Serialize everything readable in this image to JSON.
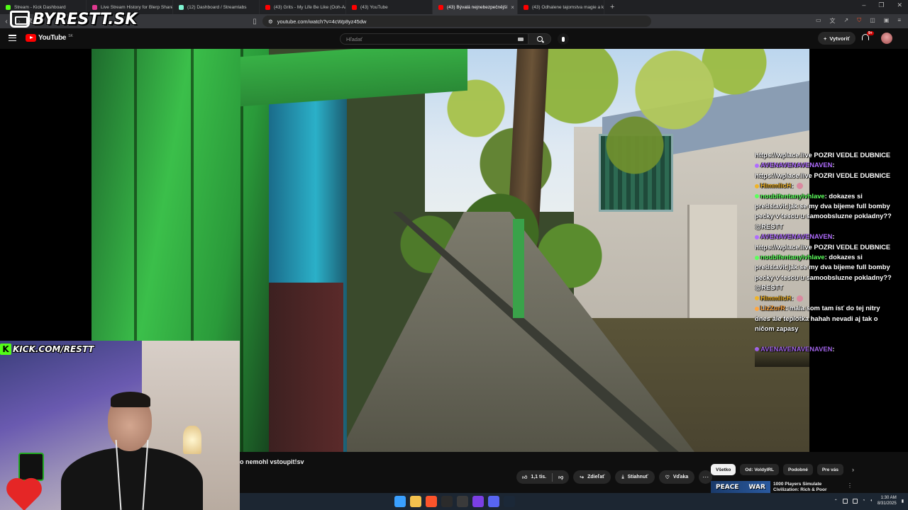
{
  "browser": {
    "tabs": [
      {
        "label": "Stream - Kick Dashboard",
        "icon": "kick-icon",
        "color": "#53fc18"
      },
      {
        "label": "Live Stream History for Blerp Shares",
        "icon": "blerp-icon",
        "color": "#e0398f"
      },
      {
        "label": "(12) Dashboard / Streamlabs",
        "icon": "streamlabs-icon",
        "color": "#80f5d2"
      },
      {
        "label": "(43) Grits - My Life Be Like (Ooh-Aah)",
        "icon": "youtube-icon",
        "color": "#ff0000"
      },
      {
        "label": "(43) YouTube",
        "icon": "youtube-icon",
        "color": "#ff0000"
      },
      {
        "label": "(43) Bývalá nejnebezpečnější",
        "icon": "youtube-icon",
        "color": "#ff0000",
        "active": true
      },
      {
        "label": "(43) Odhalene tajomstva magie a ku",
        "icon": "youtube-icon",
        "color": "#ff0000"
      }
    ],
    "new_tab": "+",
    "url": "youtube.com/watch?v=4cWp8yz45dw"
  },
  "watermark": {
    "text": "BYRESTT.SK"
  },
  "youtube": {
    "logo_text": "YouTube",
    "country": "SK",
    "search_placeholder": "Hľadať",
    "create_label": "Vytvoriť",
    "notif_badge": "9+"
  },
  "chat": {
    "messages": [
      {
        "user": "",
        "text": "https://wplace.live POZRI VEDLE DUBNICE",
        "color": "#ffffff"
      },
      {
        "user": "AVENAVENAVENAVEN",
        "text": "",
        "color": "#b06cff"
      },
      {
        "user": "",
        "text": "https://wplace.live POZRI VEDLE DUBNICE",
        "color": "#ffffff"
      },
      {
        "user": "HimmlicH",
        "text": "",
        "color": "#f0b429"
      },
      {
        "user": "noubifentanylvhlave",
        "text": "dokazes si",
        "color": "#5dff5d"
      },
      {
        "user": "",
        "text": "predstavit jak se my dva bijeme full bomby",
        "color": "#ffffff"
      },
      {
        "user": "",
        "text": "pecky v tescu u samoobsluzne pokladny??",
        "color": "#ffffff"
      },
      {
        "user": "",
        "text": "@RESTT",
        "color": "#ffffff"
      },
      {
        "user": "AVENAVENAVENAVEN",
        "text": "",
        "color": "#b06cff"
      },
      {
        "user": "",
        "text": "https://wplace.live POZRI VEDLE DUBNICE",
        "color": "#ffffff"
      },
      {
        "user": "noubifentanylvhlave",
        "text": "dokazes si",
        "color": "#5dff5d"
      },
      {
        "user": "",
        "text": "predstavit jak se my dva bijeme full bomby",
        "color": "#ffffff"
      },
      {
        "user": "",
        "text": "pecky v tescu u samoobsluzne pokladny??",
        "color": "#ffffff"
      },
      {
        "user": "",
        "text": "@RESTT",
        "color": "#ffffff"
      },
      {
        "user": "HimmlicH",
        "text": "",
        "color": "#f0b429"
      },
      {
        "user": "LizZurR",
        "text": "mala som tam ísť do tej nitry",
        "color": "#ffa640"
      },
      {
        "user": "",
        "text": "dnes ale teplotka hahah nevadi aj tak o",
        "color": "#ffffff"
      },
      {
        "user": "",
        "text": "ničom zapasy",
        "color": "#ffffff"
      },
      {
        "user": "",
        "text": "",
        "color": "#ffffff"
      },
      {
        "user": "AVENAVENAVENAVEN",
        "text": "",
        "color": "#b06cff"
      }
    ]
  },
  "webcam": {
    "kick_url": "KICK.COM/RESTT",
    "kick_glyph": "K"
  },
  "video": {
    "title_fragment": "o nemohl vstoupit!sv",
    "like_count": "1,1 tis.",
    "share_label": "Zdieľať",
    "download_label": "Stiahnuť",
    "thanks_label": "Vďaka",
    "more": "⋯"
  },
  "sidebar": {
    "chips": [
      {
        "label": "Všetko",
        "active": true
      },
      {
        "label": "Od: VoldyIRL"
      },
      {
        "label": "Podobné"
      },
      {
        "label": "Pre vás"
      }
    ],
    "chip_next": "›",
    "rec_thumb_words": [
      "PEACE",
      "WAR"
    ],
    "rec_title": "1000 Players Simulate Civilization: Rich & Poor",
    "rec_more": "⋮"
  },
  "taskbar": {
    "time": "1:30 AM",
    "date": "8/31/2025",
    "icons": [
      {
        "name": "windows-start-icon",
        "color": "#3aa0ff"
      },
      {
        "name": "file-explorer-icon",
        "color": "#f2c14e"
      },
      {
        "name": "brave-browser-icon",
        "color": "#fb542b"
      },
      {
        "name": "terminal-icon",
        "color": "#2b2b2b"
      },
      {
        "name": "obs-icon",
        "color": "#3a3a3a"
      },
      {
        "name": "app-purple-icon",
        "color": "#7b3fe4"
      },
      {
        "name": "discord-icon",
        "color": "#5865f2"
      },
      {
        "name": "steam-icon",
        "color": "#1b2838"
      }
    ]
  }
}
